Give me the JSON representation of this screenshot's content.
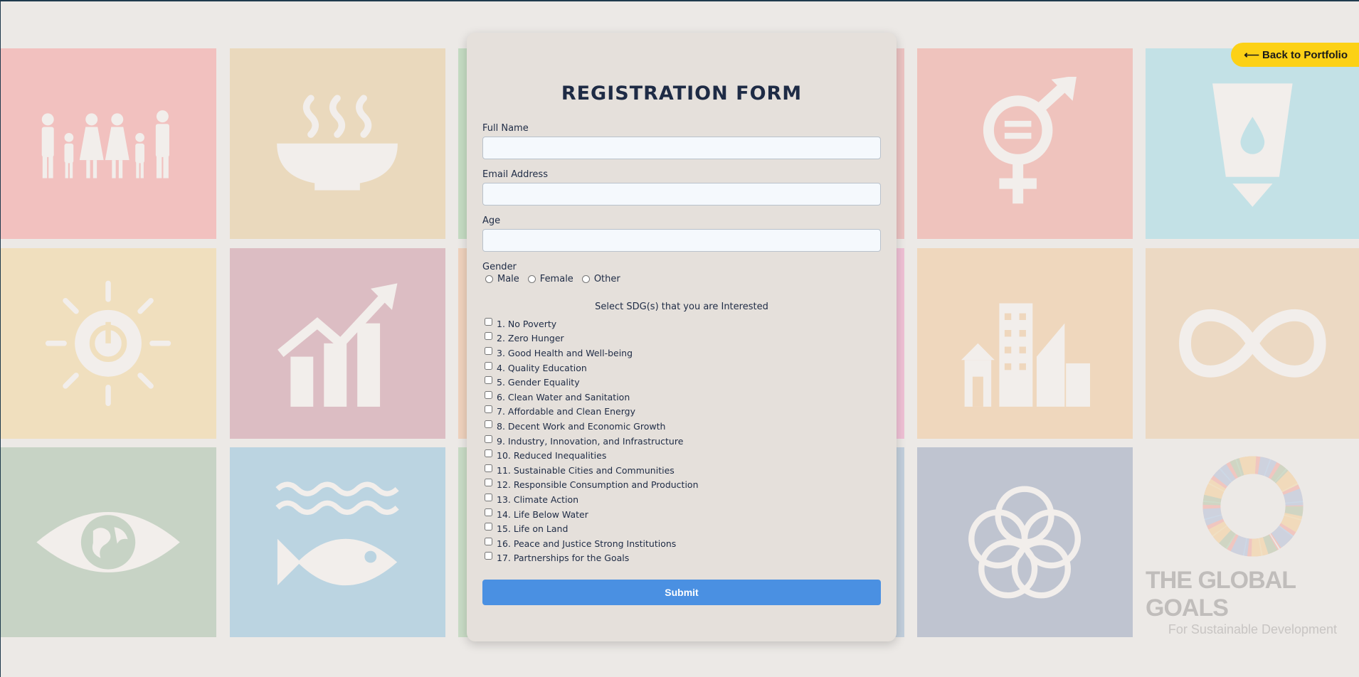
{
  "back_button": {
    "label": "⟵ Back to Portfolio"
  },
  "form": {
    "title": "REGISTRATION FORM",
    "fields": {
      "full_name": {
        "label": "Full Name",
        "value": ""
      },
      "email": {
        "label": "Email Address",
        "value": ""
      },
      "age": {
        "label": "Age",
        "value": ""
      }
    },
    "gender": {
      "label": "Gender",
      "options": [
        "Male",
        "Female",
        "Other"
      ]
    },
    "sdg_heading": "Select SDG(s) that you are Interested",
    "sdgs": [
      "1. No Poverty",
      "2. Zero Hunger",
      "3. Good Health and Well-being",
      "4. Quality Education",
      "5. Gender Equality",
      "6. Clean Water and Sanitation",
      "7. Affordable and Clean Energy",
      "8. Decent Work and Economic Growth",
      "9. Industry, Innovation, and Infrastructure",
      "10. Reduced Inequalities",
      "11. Sustainable Cities and Communities",
      "12. Responsible Consumption and Production",
      "13. Climate Action",
      "14. Life Below Water",
      "15. Life on Land",
      "16. Peace and Justice Strong Institutions",
      "17. Partnerships for the Goals"
    ],
    "submit_label": "Submit"
  },
  "background": {
    "logo_title": "THE GLOBAL GOALS",
    "logo_subtitle": "For Sustainable Development",
    "tiles": [
      {
        "icon": "family-icon",
        "color": "#f2c1bf"
      },
      {
        "icon": "soup-bowl-icon",
        "color": "#ead9bd"
      },
      {
        "icon": "heartbeat-icon",
        "color": "#c5dcc3"
      },
      {
        "icon": "book-pen-icon",
        "color": "#ecc3c2"
      },
      {
        "icon": "gender-equality-icon",
        "color": "#efc3bd"
      },
      {
        "icon": "water-glass-icon",
        "color": "#c3e1e6"
      },
      {
        "icon": "sun-power-icon",
        "color": "#f0dfbe"
      },
      {
        "icon": "growth-chart-icon",
        "color": "#dcbdc3"
      },
      {
        "icon": "cubes-icon",
        "color": "#efd2bd"
      },
      {
        "icon": "equals-arrows-icon",
        "color": "#efc0d5"
      },
      {
        "icon": "city-buildings-icon",
        "color": "#efd7bd"
      },
      {
        "icon": "infinity-icon",
        "color": "#ecd9c3"
      },
      {
        "icon": "earth-eye-icon",
        "color": "#c7d3c5"
      },
      {
        "icon": "fish-waves-icon",
        "color": "#bbd4e1"
      },
      {
        "icon": "tree-birds-icon",
        "color": "#c9dcc6"
      },
      {
        "icon": "dove-gavel-icon",
        "color": "#c2cfdc"
      },
      {
        "icon": "rings-partnership-icon",
        "color": "#bfc4d0"
      },
      {
        "icon": "global-goals-wheel-icon",
        "color": "#ece9e6"
      }
    ]
  }
}
